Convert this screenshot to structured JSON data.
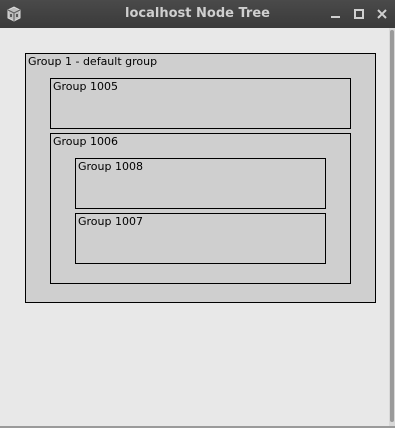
{
  "window": {
    "title": "localhost Node Tree"
  },
  "titlebar_buttons": {
    "minimize_icon": "minimize-icon",
    "maximize_icon": "maximize-icon",
    "close_icon": "close-icon"
  },
  "groups": {
    "root": {
      "label": "Group 1 - default group"
    },
    "g1005": {
      "label": "Group 1005"
    },
    "g1006": {
      "label": "Group 1006"
    },
    "g1008": {
      "label": "Group 1008"
    },
    "g1007": {
      "label": "Group 1007"
    }
  },
  "colors": {
    "titlebar": "#3a3a3a",
    "group_fill": "#cfcfcf",
    "background": "#e8e8e8"
  }
}
